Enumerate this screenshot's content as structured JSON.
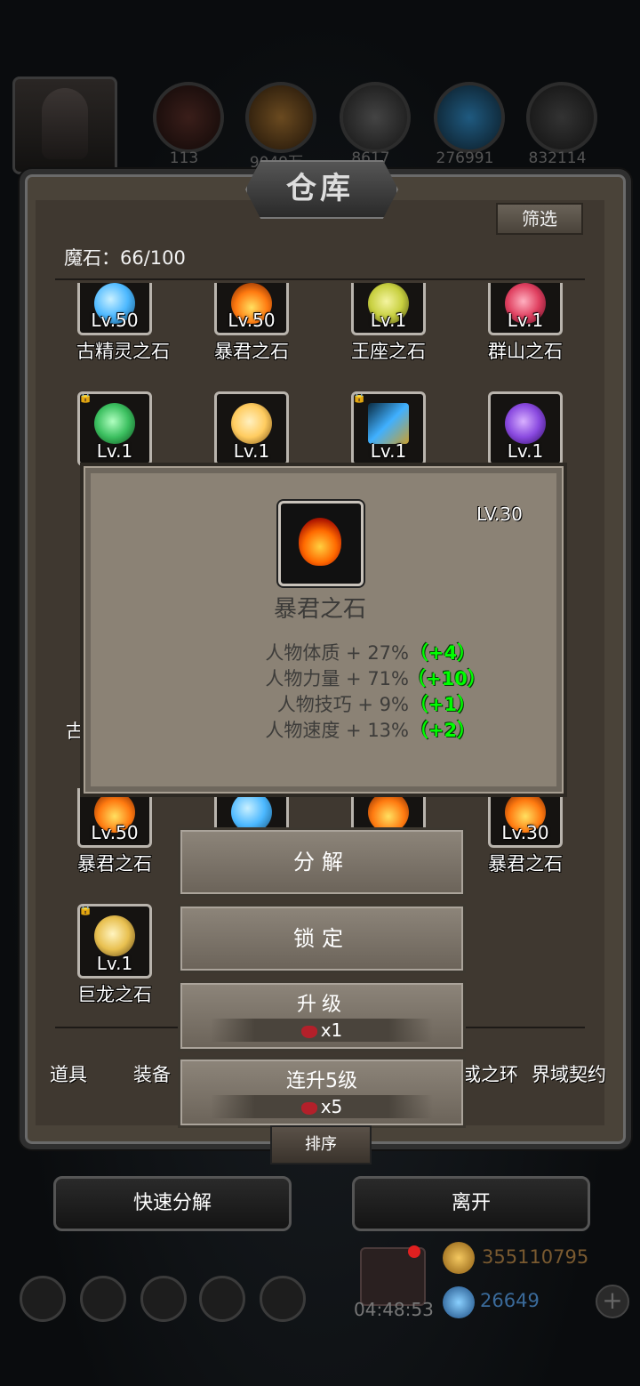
{
  "window": {
    "title": "仓库",
    "filter_label": "筛选"
  },
  "top_bar": {
    "resources": [
      {
        "icon": "ore-icon",
        "value": "113",
        "color": "#c0602a"
      },
      {
        "icon": "wood-icon",
        "value": "9049万",
        "color": "#c07a30"
      },
      {
        "icon": "iron-icon",
        "value": "8617",
        "color": "#777777"
      },
      {
        "icon": "crystal-icon",
        "value": "276991",
        "color": "#3aa0d8"
      },
      {
        "icon": "steel-icon",
        "value": "832114",
        "color": "#555555"
      }
    ]
  },
  "magic_stone": {
    "label": "魔石：66/100"
  },
  "grid": {
    "row1": [
      {
        "level": "Lv.50",
        "name": "古精灵之石",
        "color": "#4cb8ff"
      },
      {
        "level": "Lv.50",
        "name": "暴君之石",
        "color": "#ff7a10"
      },
      {
        "level": "Lv.1",
        "name": "王座之石",
        "color": "#c8d040"
      },
      {
        "level": "Lv.1",
        "name": "群山之石",
        "color": "#e04060"
      }
    ],
    "row2": [
      {
        "level": "Lv.1",
        "locked": true,
        "color": "#3cc060"
      },
      {
        "level": "Lv.1",
        "locked": false,
        "color": "#ffcc60"
      },
      {
        "level": "Lv.1",
        "locked": true,
        "color": "#40b0ff"
      },
      {
        "level": "Lv.1",
        "locked": false,
        "color": "#8a4ae0"
      }
    ],
    "row3_partial_name": "古",
    "row4": [
      {
        "level": "Lv.50",
        "name": "暴君之石",
        "color": "#ff7a10"
      },
      {
        "level": "",
        "name": "",
        "color": "#4cb8ff"
      },
      {
        "level": "",
        "name": "",
        "color": "#ff7a10"
      },
      {
        "level": "Lv.30",
        "name": "暴君之石",
        "color": "#ff7a10"
      }
    ],
    "row5": [
      {
        "level": "Lv.1",
        "name": "巨龙之石",
        "locked": true,
        "color": "#e8c050"
      }
    ]
  },
  "tabs": [
    "道具",
    "装备",
    "或之环",
    "界域契约"
  ],
  "popup": {
    "level": "LV.30",
    "name": "暴君之石",
    "stats": [
      {
        "text": "人物体质 + 27%",
        "bonus": "（+4）"
      },
      {
        "text": "人物力量 + 71%",
        "bonus": "（+10）"
      },
      {
        "text": "人物技巧 + 9%",
        "bonus": "（+1）"
      },
      {
        "text": "人物速度 + 13%",
        "bonus": "（+2）"
      }
    ]
  },
  "actions": {
    "decompose": "分解",
    "lock": "锁定",
    "upgrade": {
      "label": "升级",
      "cost": "x1"
    },
    "upgrade5": {
      "label": "连升5级",
      "cost": "x5"
    }
  },
  "bottom": {
    "sort": "排序",
    "quick_decompose": "快速分解",
    "leave": "离开"
  },
  "hud": {
    "timer": "04:48:53",
    "gold": "355110795",
    "gems": "26649"
  }
}
